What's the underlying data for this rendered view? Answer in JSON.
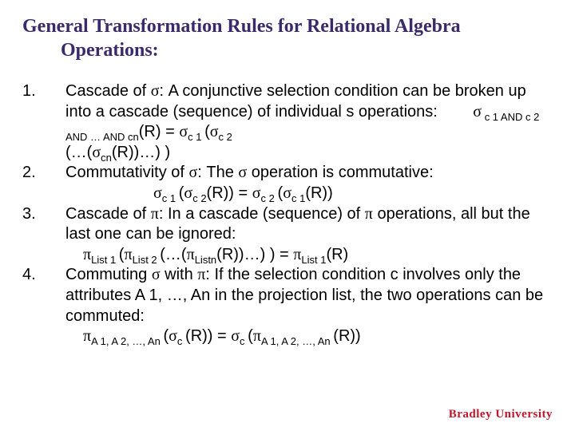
{
  "title": {
    "line1": "General Transformation Rules for Relational Algebra",
    "line2": "Operations:"
  },
  "sigma": "σ",
  "pi": "π",
  "items": [
    {
      "num": "1.",
      "lead": "Cascade of ",
      "after_sym": ": A conjunctive selection condition can be broken up into a cascade (sequence) of individual s operations:",
      "formula_main_sub1": " c 1 AND c 2 AND … AND cn",
      "formula_main_mid": "(R) = ",
      "formula_sub_c1": "c 1 ",
      "formula_open": "(",
      "formula_sub_c2": "c 2",
      "tail_pre": "(…(",
      "tail_sub_cn": "cn",
      "tail_post": "(R))…) )"
    },
    {
      "num": "2.",
      "lead": "Commutativity of ",
      "after_sym1": ": The ",
      "after_sym2": " operation is commutative:",
      "f_sub1": "c 1 ",
      "f_open1": "(",
      "f_sub2": "c 2",
      "f_mid": "(R)) = ",
      "f_sub3": "c 2 ",
      "f_open2": "(",
      "f_sub4": "c 1",
      "f_close": "(R))"
    },
    {
      "num": "3.",
      "lead": "Cascade of ",
      "after_sym1": ": In a cascade (sequence) of  ",
      "after_sym2": " operations, all but the last one can be ignored:",
      "f_sub1": "List 1 ",
      "f_open1": "(",
      "f_sub2": "List 2 ",
      "f_paren1": "(…(",
      "f_subn": "Listn",
      "f_mid": "(R))…) ) = ",
      "f_sub_r": "List 1",
      "f_close": "(R)"
    },
    {
      "num": "4.",
      "lead": "Commuting ",
      "mid1": " with ",
      "after_sym": ": If the selection condition c involves only the attributes A 1, …, An in the projection list, the two operations can be commuted:",
      "f_sub_a": "A 1, A 2, …, An ",
      "f_open1": "(",
      "f_sub_c": "c ",
      "f_mid": "(R)) = ",
      "f_sub_c2": "c ",
      "f_open2": "(",
      "f_sub_a2": "A 1, A 2, …, An ",
      "f_close": "(R))"
    }
  ],
  "footer": "Bradley University"
}
